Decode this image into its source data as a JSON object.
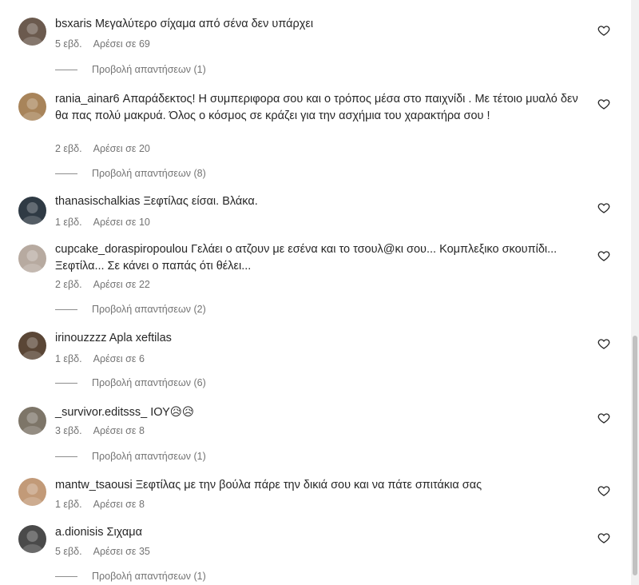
{
  "comments": [
    {
      "username": "bsxaris",
      "text": "Μεγαλύτερο σίχαμα από σένα δεν υπάρχει",
      "time": "5 εβδ.",
      "likes": "Αρέσει σε 69",
      "replies": "Προβολή απαντήσεων (1)",
      "avatar_color": "#6b5a4e"
    },
    {
      "username": "rania_ainar6",
      "text": "Απαράδεκτος! Η συμπεριφορα σου και ο τρόπος μέσα στο παιχνίδι . Με τέτοιο μυαλό δεν θα πας πολύ μακρυά. Όλος ο κόσμος σε κράζει για την ασχήμια του χαρακτήρα σου !",
      "time": "2 εβδ.",
      "likes": "Αρέσει σε 20",
      "replies": "Προβολή απαντήσεων (8)",
      "avatar_color": "#a8845a"
    },
    {
      "username": "thanasischalkias",
      "text": "Ξεφτίλας είσαι. Βλάκα.",
      "time": "1 εβδ.",
      "likes": "Αρέσει σε 10",
      "replies": "",
      "avatar_color": "#2f3a44"
    },
    {
      "username": "cupcake_doraspiropoulou",
      "text": "Γελάει ο ατζουν με εσένα και το τσουλ@κι σου... Κομπλεξικο σκουπίδι... Ξεφτίλα... Σε κάνει ο παπάς ότι θέλει...",
      "time": "2 εβδ.",
      "likes": "Αρέσει σε 22",
      "replies": "Προβολή απαντήσεων (2)",
      "avatar_color": "#b7aaa0"
    },
    {
      "username": "irinouzzzz",
      "text": "Apla xeftilas",
      "time": "1 εβδ.",
      "likes": "Αρέσει σε 6",
      "replies": "Προβολή απαντήσεων (6)",
      "avatar_color": "#5a4636"
    },
    {
      "username": "_survivor.editsss_",
      "text": "ΙΟΥ😥😥",
      "time": "3 εβδ.",
      "likes": "Αρέσει σε 8",
      "replies": "Προβολή απαντήσεων (1)",
      "avatar_color": "#7d7568"
    },
    {
      "username": "mantw_tsaousi",
      "text": "Ξεφτίλας με την βούλα πάρε την δικιά σου και να πάτε σπιτάκια σας",
      "time": "1 εβδ.",
      "likes": "Αρέσει σε 8",
      "replies": "",
      "avatar_color": "#c29a78"
    },
    {
      "username": "a.dionisis",
      "text": "Σιχαμα",
      "time": "5 εβδ.",
      "likes": "Αρέσει σε 35",
      "replies": "Προβολή απαντήσεων (1)",
      "avatar_color": "#4a4a4a"
    }
  ],
  "icons": {
    "like": "heart-outline-icon"
  },
  "colors": {
    "text": "#262626",
    "secondary": "#737373",
    "background": "#ffffff"
  }
}
